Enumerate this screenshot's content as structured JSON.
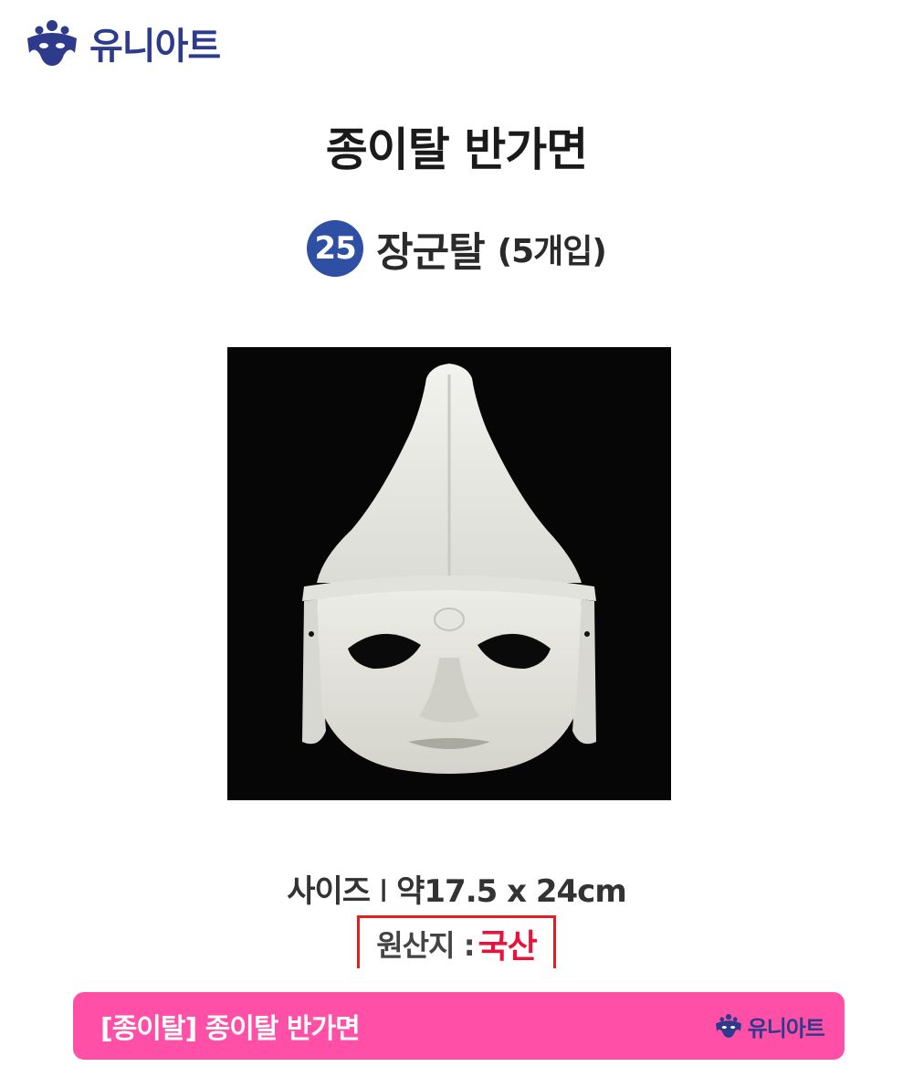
{
  "brand": {
    "name": "유니아트",
    "color": "#2e3a8c"
  },
  "product": {
    "title": "종이탈 반가면",
    "number": "25",
    "name": "장군탈",
    "count": "(5개입)"
  },
  "specs": {
    "size_label": "사이즈",
    "separator": "I",
    "size_value": "약17.5 x 24cm",
    "origin_label": "원산지 :",
    "origin_value": "국산"
  },
  "footer": {
    "title": "[종이탈] 종이탈 반가면",
    "brand": "유니아트",
    "bg_color": "#ff4fa6"
  },
  "icons": {
    "logo": "crown-mask-logo-icon"
  }
}
